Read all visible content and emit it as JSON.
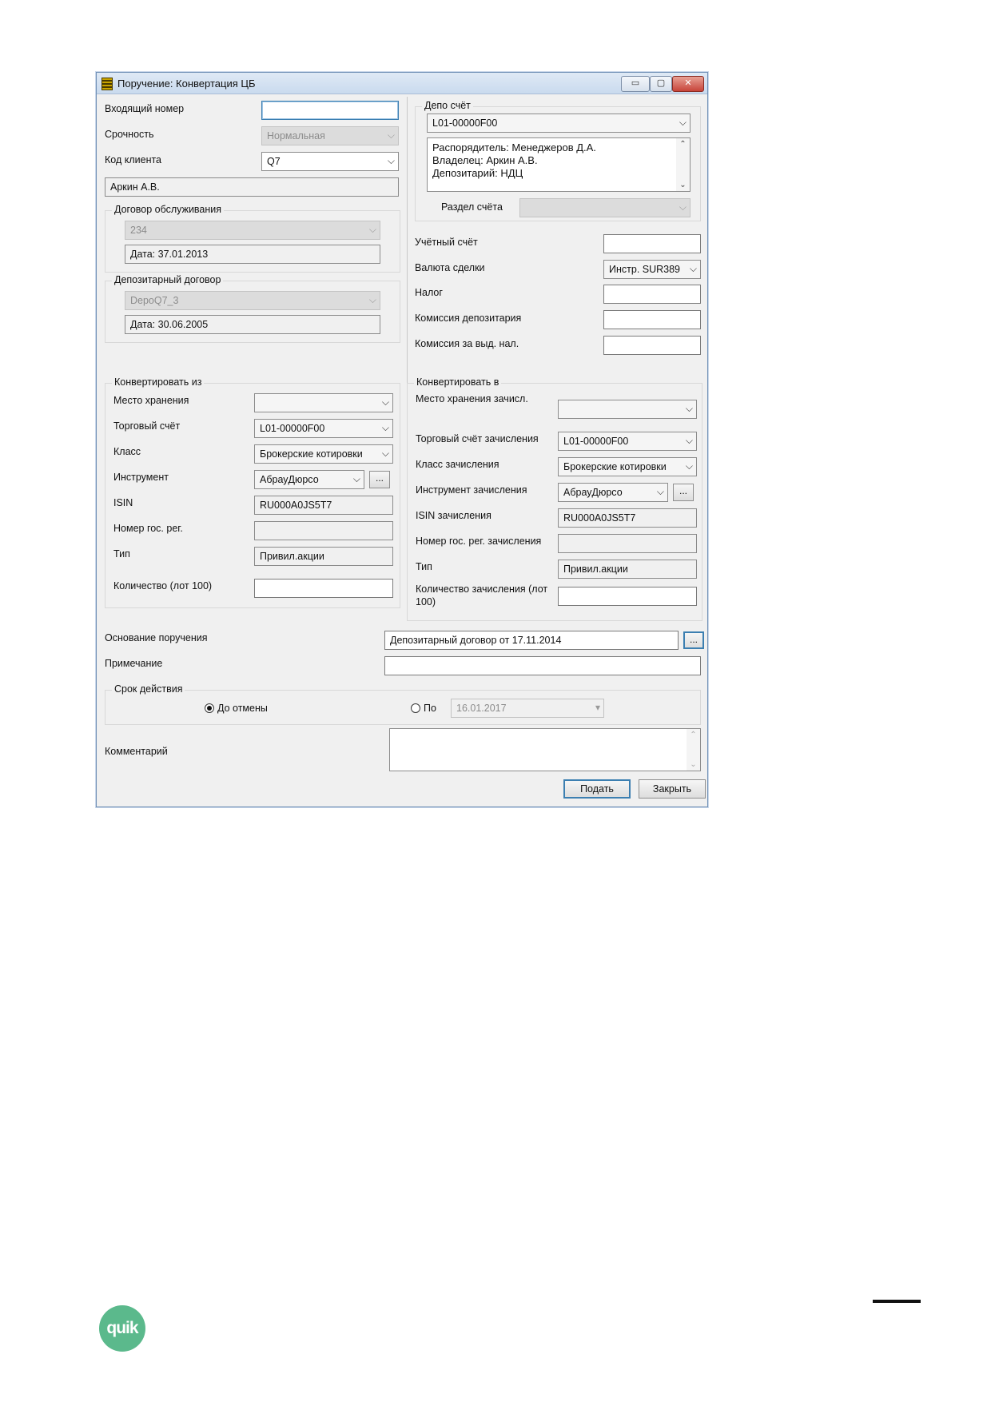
{
  "window": {
    "title": "Поручение: Конвертация ЦБ",
    "min_glyph": "▭",
    "max_glyph": "▢",
    "close_glyph": "✕"
  },
  "left_top": {
    "incoming_number_label": "Входящий номер",
    "incoming_number_value": "",
    "urgency_label": "Срочность",
    "urgency_value": "Нормальная",
    "client_code_label": "Код клиента",
    "client_code_value": "Q7",
    "client_name": "Аркин А.В.",
    "service_group": {
      "title": "Договор обслуживания",
      "value": "234",
      "date": "Дата: 37.01.2013"
    },
    "depo_group": {
      "title": "Депозитарный договор",
      "value": "DepoQ7_3",
      "date": "Дата: 30.06.2005"
    }
  },
  "right_top": {
    "depo_account_title": "Депо счёт",
    "depo_account_value": "L01-00000F00",
    "info_lines": [
      "Распорядитель: Менеджеров Д.А.",
      "Владелец: Аркин А.В.",
      "Депозитарий: НДЦ"
    ],
    "section_label": "Раздел счёта",
    "section_value": "",
    "accounting_label": "Учётный счёт",
    "currency_label": "Валюта сделки",
    "currency_value": "Инстр. SUR389",
    "tax_label": "Налог",
    "depo_commission_label": "Комиссия депозитария",
    "tax_commission_label": "Комиссия за выд. нал."
  },
  "convert_from": {
    "title": "Конвертировать из",
    "storage_label": "Место хранения",
    "trade_account_label": "Торговый счёт",
    "trade_account_value": "L01-00000F00",
    "class_label": "Класс",
    "class_value": "Брокерские котировки",
    "instrument_label": "Инструмент",
    "instrument_value": "АбрауДюрсо",
    "isin_label": "ISIN",
    "isin_value": "RU000A0JS5T7",
    "reg_label": "Номер гос. рег.",
    "type_label": "Тип",
    "type_value": "Привил.акции",
    "qty_label": "Количество (лот 100)"
  },
  "convert_to": {
    "title": "Конвертировать в",
    "storage_label": "Место хранения зачисл.",
    "trade_account_label": "Торговый счёт зачисления",
    "trade_account_value": "L01-00000F00",
    "class_label": "Класс зачисления",
    "class_value": "Брокерские котировки",
    "instrument_label": "Инструмент зачисления",
    "instrument_value": "АбрауДюрсо",
    "isin_label": "ISIN зачисления",
    "isin_value": "RU000A0JS5T7",
    "reg_label": "Номер гос. рег. зачисления",
    "type_label": "Тип",
    "type_value": "Привил.акции",
    "qty_label_1": "Количество зачисления (лот",
    "qty_label_2": "100)"
  },
  "bottom": {
    "basis_label": "Основание поручения",
    "basis_value": "Депозитарный договор от 17.11.2014",
    "note_label": "Примечание",
    "validity_title": "Срок действия",
    "until_cancel": "До отмены",
    "until_date_label": "По",
    "until_date_value": "16.01.2017",
    "comment_label": "Комментарий",
    "submit": "Подать",
    "close": "Закрыть",
    "dots": "..."
  },
  "footer": {
    "logo_text": "quik"
  },
  "colors": {
    "logo_green": "#5bb98c",
    "window_bg": "#f0f0f0",
    "focus_blue": "#3c7fb1"
  }
}
